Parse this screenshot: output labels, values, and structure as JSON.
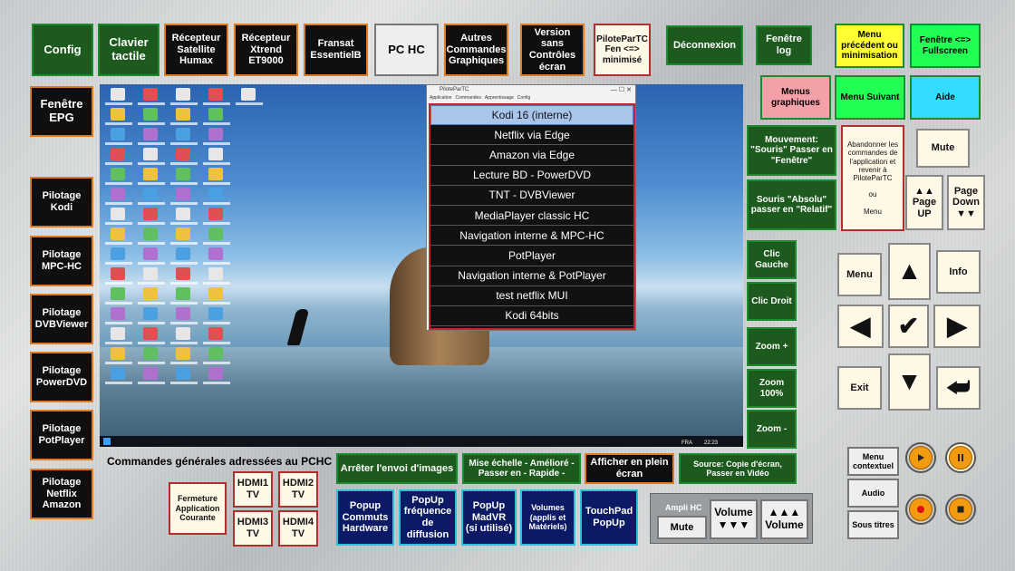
{
  "top": {
    "config": "Config",
    "clavier": "Clavier tactile",
    "humax": "Récepteur Satellite Humax",
    "xtrend": "Récepteur Xtrend ET9000",
    "fransat": "Fransat EssentielB",
    "pchc": "PC HC",
    "autres": "Autres Commandes Graphiques",
    "version": "Version sans Contrôles écran",
    "pilote_fen": "PiloteParTC Fen <=> minimisé",
    "deconnexion": "Déconnexion",
    "fenetre_log": "Fenêtre log",
    "menu_precedent": "Menu précédent ou minimisation",
    "fullscreen": "Fenêtre <=> Fullscreen"
  },
  "right_top": {
    "menus_graphiques": "Menus graphiques",
    "menu_suivant": "Menu Suivant",
    "aide": "Aide",
    "mouvement": "Mouvement: \"Souris\" Passer en \"Fenêtre\"",
    "souris_absolu": "Souris \"Absolu\" passer en \"Relatif\"",
    "abandonner": "Abandonner les commandes de l'application et revenir à PiloteParTC\n\nou\n\nMenu",
    "mute": "Mute",
    "page_up": "▲▲\nPage UP",
    "page_down": "Page Down\n▼▼"
  },
  "mouse": {
    "clic_gauche": "Clic Gauche",
    "clic_droit": "Clic Droit",
    "zoom_plus": "Zoom +",
    "zoom_100": "Zoom 100%",
    "zoom_moins": "Zoom -"
  },
  "nav": {
    "menu": "Menu",
    "info": "Info",
    "exit": "Exit",
    "up": "▲",
    "down": "▼",
    "left": "◀",
    "right": "▶",
    "ok": "✔",
    "back": "⮨"
  },
  "left": {
    "epg": "Fenêtre EPG",
    "kodi": "Pilotage Kodi",
    "mpc": "Pilotage MPC-HC",
    "dvb": "Pilotage DVBViewer",
    "powerdvd": "Pilotage PowerDVD",
    "potplayer": "Pilotage PotPlayer",
    "netflix": "Pilotage Netflix Amazon"
  },
  "popup": {
    "title": "PiloteParTC",
    "controls": "—  ☐  ✕",
    "menu": [
      "Application",
      "Commandes",
      "Apprentissage",
      "Config"
    ],
    "items": [
      "Kodi 16 (interne)",
      "Netflix via Edge",
      "Amazon via Edge",
      "Lecture BD - PowerDVD",
      "TNT - DVBViewer",
      "MediaPlayer classic HC",
      "Navigation interne & MPC-HC",
      "PotPlayer",
      "Navigation interne & PotPlayer",
      "test netflix MUI",
      "Kodi 64bits"
    ],
    "selected_index": 0
  },
  "taskbar": {
    "lang": "FRA",
    "clock": "22:23"
  },
  "bottom": {
    "section_label": "Commandes générales adressées au PCHC",
    "fermeture": "Fermeture Application Courante",
    "hdmi1": "HDMI1 TV",
    "hdmi2": "HDMI2 TV",
    "hdmi3": "HDMI3 TV",
    "hdmi4": "HDMI4 TV",
    "arreter": "Arrêter l'envoi d'images",
    "mise_echelle": "Mise échelle - Amélioré - Passer en - Rapide -",
    "plein_ecran": "Afficher en plein écran",
    "source": "Source: Copie d'écran, Passer en Vidéo",
    "popup_commuts": "Popup Commuts Hardware",
    "popup_freq": "PopUp fréquence de diffusion",
    "popup_madvr": "PopUp MadVR (si utilisé)",
    "volumes": "Volumes (applis et Matériels)",
    "touchpad": "TouchPad PopUp",
    "ampli": "Ampli HC",
    "mute": "Mute",
    "vol_down": "Volume\n▼▼▼",
    "vol_up": "▲▲▲\nVolume",
    "menu_contextuel": "Menu contextuel",
    "audio": "Audio",
    "sous_titres": "Sous titres"
  }
}
